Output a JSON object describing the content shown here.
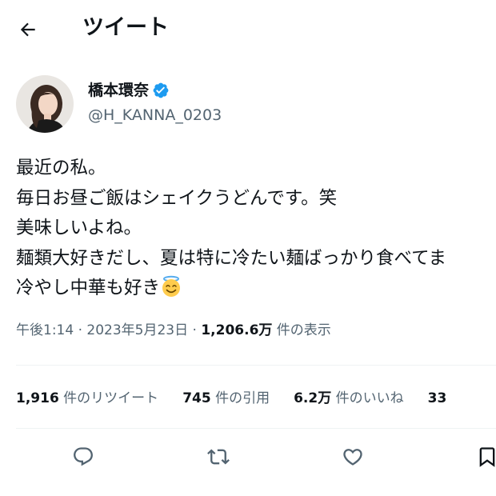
{
  "header": {
    "title": "ツイート"
  },
  "author": {
    "display_name": "橋本環奈",
    "handle": "@H_KANNA_0203",
    "verified_color": "#1d9bf0"
  },
  "tweet": {
    "lines": [
      "最近の私。",
      "毎日お昼ご飯はシェイクうどんです。笑",
      "美味しいよね。",
      "麺類大好きだし、夏は特に冷たい麺ばっかり食べてま",
      "冷やし中華も好き"
    ],
    "emoji": "smiling-face-with-halo"
  },
  "meta": {
    "time": "午後1:14",
    "sep1": " · ",
    "date": "2023年5月23日",
    "sep2": " · ",
    "views_count": "1,206.6万",
    "views_label": " 件の表示"
  },
  "stats": {
    "retweets_count": "1,916",
    "retweets_label": " 件のリツイート",
    "quotes_count": "745",
    "quotes_label": " 件の引用",
    "likes_count": "6.2万",
    "likes_label": " 件のいいね",
    "bookmarks_count": "33"
  },
  "actions": {
    "reply_icon": "reply-icon",
    "retweet_icon": "retweet-icon",
    "like_icon": "heart-icon",
    "bookmark_icon": "bookmark-icon"
  },
  "colors": {
    "text_primary": "#0f1419",
    "text_secondary": "#536471",
    "divider": "#eff3f4",
    "accent": "#1d9bf0"
  }
}
